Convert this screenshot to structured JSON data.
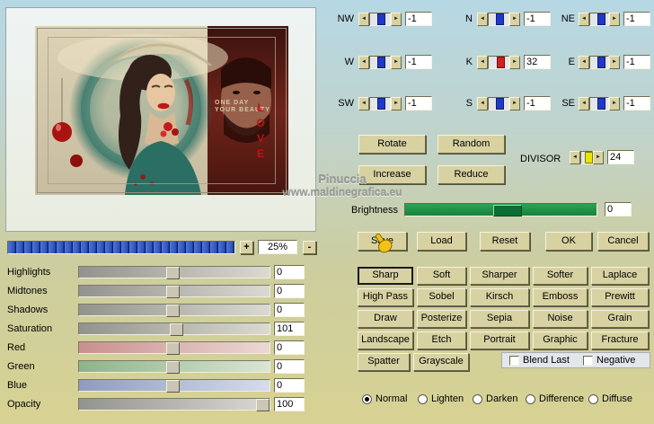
{
  "preview": {
    "watermark_line1": "Pinuccia",
    "watermark_line2": "www.maldinegrafica.eu",
    "caption_line1": "ONE DAY",
    "caption_line2": "YOUR BEAUTY",
    "love_text": "LOVE"
  },
  "zoom": {
    "plus_label": "+",
    "value": "25%",
    "minus_label": "-"
  },
  "adjust": {
    "rows": [
      {
        "label": "Highlights",
        "value": "0"
      },
      {
        "label": "Midtones",
        "value": "0"
      },
      {
        "label": "Shadows",
        "value": "0"
      },
      {
        "label": "Saturation",
        "value": "101"
      },
      {
        "label": "Red",
        "value": "0"
      },
      {
        "label": "Green",
        "value": "0"
      },
      {
        "label": "Blue",
        "value": "0"
      },
      {
        "label": "Opacity",
        "value": "100"
      }
    ]
  },
  "kernel": {
    "cells": [
      {
        "label": "NW",
        "value": "-1"
      },
      {
        "label": "N",
        "value": "-1"
      },
      {
        "label": "NE",
        "value": "-1"
      },
      {
        "label": "W",
        "value": "-1"
      },
      {
        "label": "K",
        "value": "32"
      },
      {
        "label": "E",
        "value": "-1"
      },
      {
        "label": "SW",
        "value": "-1"
      },
      {
        "label": "S",
        "value": "-1"
      },
      {
        "label": "SE",
        "value": "-1"
      }
    ],
    "divisor_label": "DIVISOR",
    "divisor_value": "24"
  },
  "buttons": {
    "rotate": "Rotate",
    "random": "Random",
    "increase": "Increase",
    "reduce": "Reduce",
    "save": "Save",
    "load": "Load",
    "reset": "Reset",
    "ok": "OK",
    "cancel": "Cancel"
  },
  "brightness": {
    "label": "Brightness",
    "value": "0"
  },
  "presets": [
    {
      "label": "Sharp",
      "active": true
    },
    {
      "label": "Soft"
    },
    {
      "label": "Sharper"
    },
    {
      "label": "Softer"
    },
    {
      "label": "Laplace"
    },
    {
      "label": "High Pass"
    },
    {
      "label": "Sobel"
    },
    {
      "label": "Kirsch"
    },
    {
      "label": "Emboss"
    },
    {
      "label": "Prewitt"
    },
    {
      "label": "Draw"
    },
    {
      "label": "Posterize"
    },
    {
      "label": "Sepia"
    },
    {
      "label": "Noise"
    },
    {
      "label": "Grain"
    },
    {
      "label": "Landscape"
    },
    {
      "label": "Etch"
    },
    {
      "label": "Portrait"
    },
    {
      "label": "Graphic"
    },
    {
      "label": "Fracture"
    },
    {
      "label": "Spatter"
    },
    {
      "label": "Grayscale"
    }
  ],
  "toggles": [
    {
      "label": "Blend Last",
      "checked": false
    },
    {
      "label": "Negative",
      "checked": false
    }
  ],
  "blend_modes": [
    {
      "label": "Normal",
      "selected": true
    },
    {
      "label": "Lighten",
      "selected": false
    },
    {
      "label": "Darken",
      "selected": false
    },
    {
      "label": "Difference",
      "selected": false
    },
    {
      "label": "Diffuse",
      "selected": false
    }
  ]
}
